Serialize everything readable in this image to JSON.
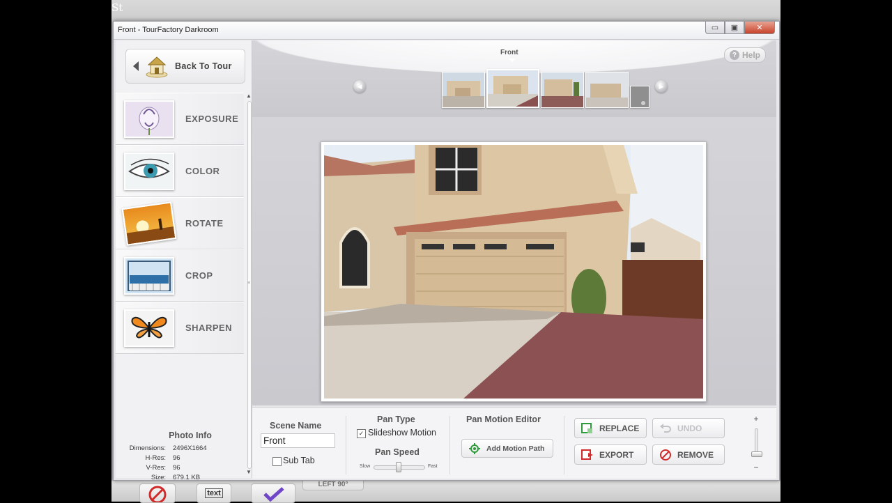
{
  "background_app": {
    "title_fragment": "St",
    "bottom_button_label": "LEFT 90°",
    "text_icon_label": "text"
  },
  "window": {
    "title": "Front - TourFactory Darkroom",
    "controls": {
      "minimize": "▭",
      "maximize": "▣",
      "close": "✕"
    }
  },
  "sidebar": {
    "back_label": "Back To Tour",
    "tools": [
      {
        "label": "EXPOSURE",
        "icon": "flower-icon"
      },
      {
        "label": "COLOR",
        "icon": "eye-icon"
      },
      {
        "label": "ROTATE",
        "icon": "sunset-icon"
      },
      {
        "label": "CROP",
        "icon": "ocean-window-icon"
      },
      {
        "label": "SHARPEN",
        "icon": "butterfly-icon"
      }
    ],
    "photo_info": {
      "title": "Photo Info",
      "rows": [
        {
          "key": "Dimensions:",
          "value": "2496X1664"
        },
        {
          "key": "H-Res:",
          "value": "96"
        },
        {
          "key": "V-Res:",
          "value": "96"
        },
        {
          "key": "Size:",
          "value": "679.1 KB"
        }
      ]
    }
  },
  "viewer": {
    "help_label": "Help",
    "current_scene": "Front",
    "filmstrip_count": 5,
    "active_index": 1
  },
  "bottom": {
    "scene_name_label": "Scene Name",
    "scene_name_value": "Front",
    "sub_tab_label": "Sub Tab",
    "sub_tab_checked": false,
    "pan_type_label": "Pan Type",
    "slideshow_motion_label": "Slideshow Motion",
    "slideshow_motion_checked": true,
    "pan_speed_label": "Pan Speed",
    "slow_label": "Slow",
    "fast_label": "Fast",
    "pan_speed_value": 0.5,
    "motion_editor_label": "Pan Motion Editor",
    "add_motion_path_label": "Add Motion Path",
    "replace_label": "REPLACE",
    "undo_label": "UNDO",
    "export_label": "EXPORT",
    "remove_label": "REMOVE",
    "zoom_plus": "+",
    "zoom_minus": "−"
  },
  "colors": {
    "accent_green": "#2e9b3a",
    "accent_red": "#d02a2a",
    "text_gray": "#666666"
  }
}
